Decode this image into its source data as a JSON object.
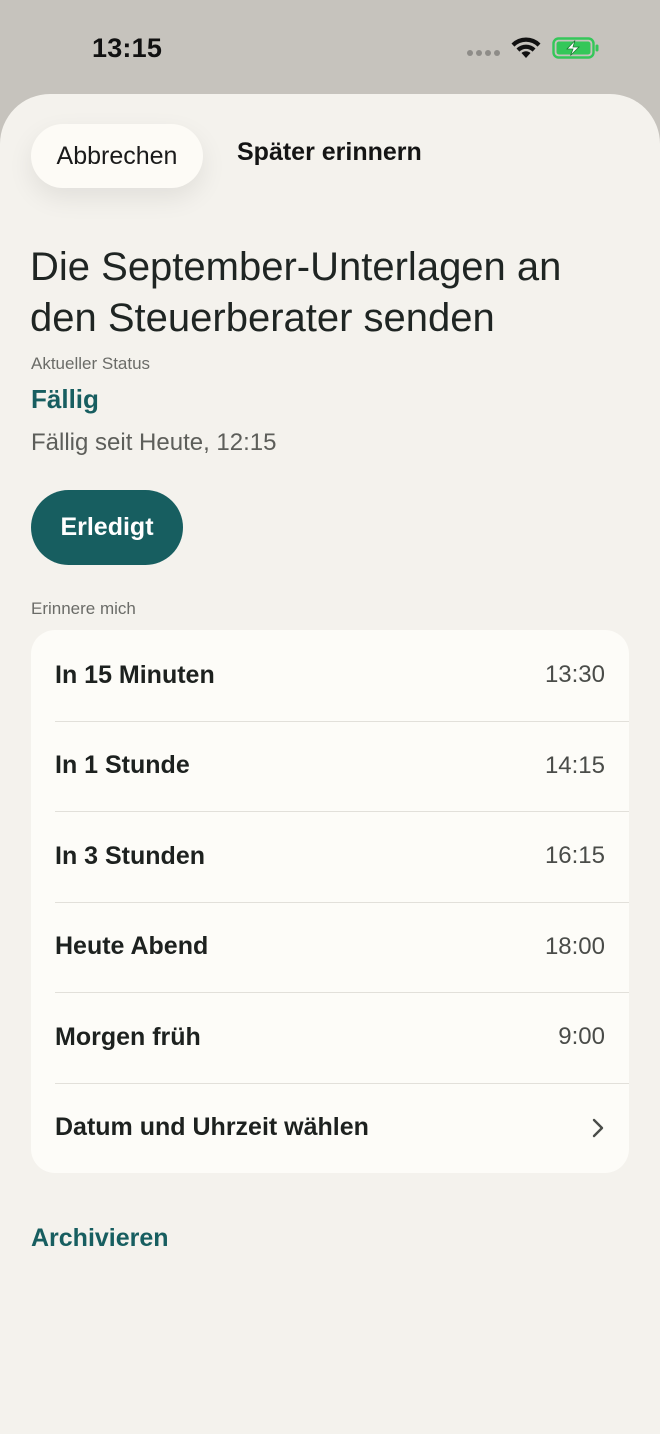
{
  "status_bar": {
    "time": "13:15"
  },
  "colors": {
    "accent": "#175e60",
    "sheet_background": "#f4f2ed",
    "list_background": "#fdfcf8",
    "battery_charging": "#34c759"
  },
  "header": {
    "cancel_label": "Abbrechen",
    "remind_later_label": "Später erinnern"
  },
  "task": {
    "title": "Die September-Unterlagen an den Steuerberater senden",
    "status_label": "Aktueller Status",
    "status_value": "Fällig",
    "status_detail": "Fällig seit Heute, 12:15"
  },
  "actions": {
    "done_label": "Erledigt",
    "archive_label": "Archivieren"
  },
  "reminders": {
    "header": "Erinnere mich",
    "options": [
      {
        "label": "In 15 Minuten",
        "time": "13:30"
      },
      {
        "label": "In 1 Stunde",
        "time": "14:15"
      },
      {
        "label": "In 3 Stunden",
        "time": "16:15"
      },
      {
        "label": "Heute Abend",
        "time": "18:00"
      },
      {
        "label": "Morgen früh",
        "time": "9:00"
      }
    ],
    "custom_label": "Datum und Uhrzeit wählen",
    "custom_icon": "chevron-right-icon"
  }
}
